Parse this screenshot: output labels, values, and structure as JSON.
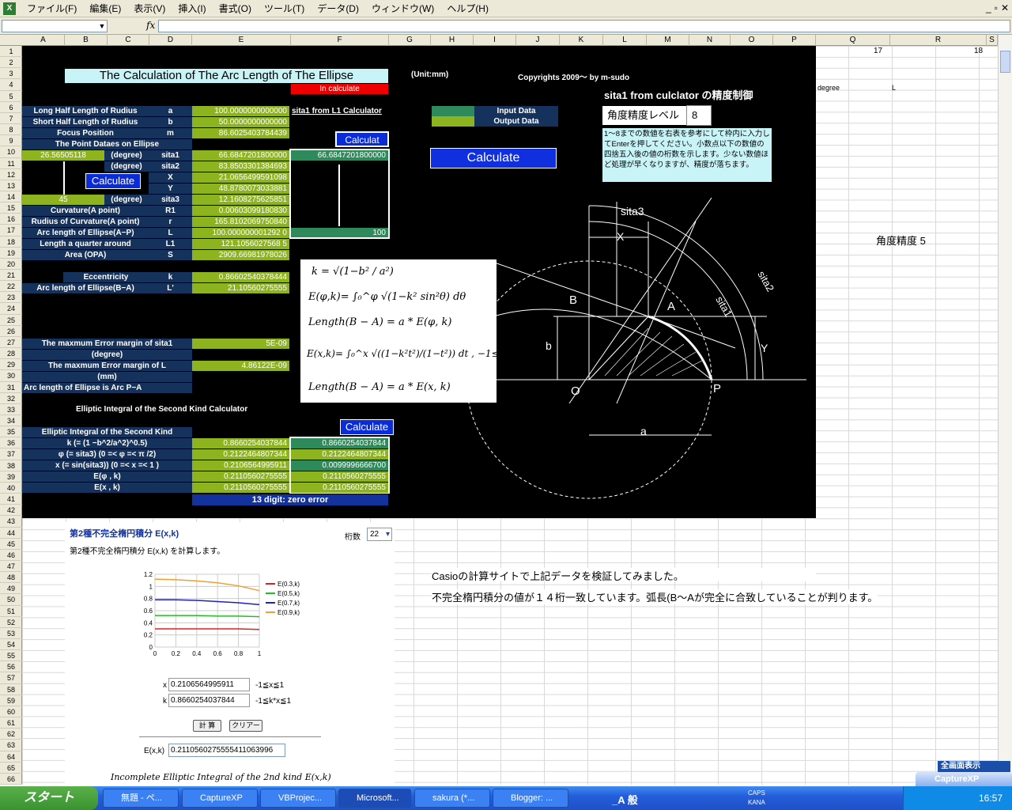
{
  "menu": [
    "ファイル(F)",
    "編集(E)",
    "表示(V)",
    "挿入(I)",
    "書式(O)",
    "ツール(T)",
    "データ(D)",
    "ウィンドウ(W)",
    "ヘルプ(H)"
  ],
  "window_controls": [
    "_",
    "▫",
    "✕"
  ],
  "formula": {
    "fx": "fx",
    "namebox_arrow": "▼"
  },
  "columns": [
    "A",
    "B",
    "C",
    "D",
    "E",
    "F",
    "G",
    "H",
    "I",
    "J",
    "K",
    "L",
    "M",
    "N",
    "O",
    "P",
    "Q",
    "R",
    "S"
  ],
  "rows": [
    "1",
    "2",
    "3",
    "4",
    "5",
    "6",
    "7",
    "8",
    "9",
    "10",
    "11",
    "12",
    "13",
    "14",
    "15",
    "16",
    "17",
    "18",
    "19",
    "20",
    "21",
    "22",
    "23",
    "24",
    "25",
    "26",
    "27",
    "28",
    "29",
    "30",
    "31",
    "32",
    "33",
    "34",
    "35",
    "36",
    "37",
    "38",
    "39",
    "40",
    "41",
    "42",
    "43",
    "44",
    "45",
    "46",
    "47",
    "48",
    "49",
    "50",
    "51",
    "52",
    "53",
    "54",
    "55",
    "56",
    "57",
    "58",
    "59",
    "60",
    "61",
    "62",
    "63",
    "64",
    "65",
    "66"
  ],
  "sheet": {
    "title": "The Calculation of The Arc Length of  The Ellipse",
    "unit": "(Unit:mm)",
    "copyright": "Copyrights 2009～ by m-sudo",
    "status": "In calculate",
    "q1": "17",
    "r1": "18",
    "q4": "degree",
    "r4": "L",
    "r_angle": "角度精度 5",
    "sita1_from": "sita1  from L1  Calculator",
    "legend_input": "Input Data",
    "legend_output": "Output Data",
    "ctrl_title": "sita1  from  culclator の精度制御",
    "ctrl_label": "角度精度レベル",
    "ctrl_value": "8",
    "ctrl_note": "1～8までの数値を右表を参考にして枠内に入力してEnterを押してください。小数点以下の数値の四捨五入後の値の桁数を示します。少ない数値ほど処理が早くなりますが、精度が落ちます。",
    "calc_btn": "Calculate",
    "calc_btn_small": "Calculat",
    "rows_main": [
      {
        "label": "Long Half Length of Rudius",
        "sym": "a",
        "val": "100.0000000000000"
      },
      {
        "label": "Short Half Length of Rudius",
        "sym": "b",
        "val": "50.0000000000000"
      },
      {
        "label": "Focus Position",
        "sym": "m",
        "val": "86.6025403784439"
      },
      {
        "label": "The Point Dataes on Ellipse",
        "sym": "",
        "val": ""
      }
    ],
    "a10": "26.56505118",
    "deg": "(degree)",
    "sym10": "sita1",
    "val10": "66.6847201800000",
    "out10": "66.6847201800000",
    "sym11": "sita2",
    "val11": "83.8503301384693",
    "sym12": "X",
    "val12": "21.0656499591098",
    "sym13": "Y",
    "val13": "48.8780073033881",
    "a14": "45",
    "sym14": "sita3",
    "val14": "12.1608275625851",
    "rows15": [
      {
        "label": "Curvature(A point)",
        "sym": "R1",
        "val": "0.00603099180830"
      },
      {
        "label": "Rudius of Curvature(A point)",
        "sym": "r",
        "val": "165.8102069750840"
      },
      {
        "label": "Arc length of Ellipse(A−P)",
        "sym": "L",
        "val": "100.000000001292 0"
      }
    ],
    "out17": "100",
    "l1_label": "Length a quarter around",
    "l1_sym": "L1",
    "l1_val": "121.1056027568 5",
    "area_label": "Area (OPA)",
    "area_sym": "S",
    "area_val": "2909.66981978026",
    "ecc_label": "Eccentricity",
    "ecc_sym": "k",
    "ecc_val": "0.86602540378444",
    "arcba_label": "Arc length of Ellipse(B−A)",
    "arcba_sym": "L'",
    "arcba_val": "21.10560275555",
    "err1_label": "The maxmum  Error margin  of sita1",
    "err1_label2": "(degree)",
    "err1_val": "5E-09",
    "err2_label": "The maxmum  Error margin  of L",
    "err2_label2": "(mm)",
    "err2_val": "4.86122E-09",
    "arcpa": "Arc length of Ellipse is Arc P−A",
    "ei_title": "Elliptic Integral of the Second Kind Calculator",
    "ei_head": "Elliptic Integral of the Second Kind",
    "ei_rows": [
      {
        "label": "k (= (1 −b^2/a^2)^0.5)",
        "v": "0.8660254037844",
        "o": "0.8660254037844"
      },
      {
        "label": "φ  (= sita3)  (0  =< φ  =< π /2)",
        "v": "0.2122464807344",
        "o": "0.2122464807344"
      },
      {
        "label": "x  (= sin(sita3))  (0  =< x =< 1 )",
        "v": "0.2106564995911",
        "o": "0.0099996666700"
      },
      {
        "label": "E(φ , k)",
        "v": "0.2110560275555",
        "o": "0.2110560275555"
      },
      {
        "label": "E(x , k)",
        "v": "0.2110560275555",
        "o": "0.2110560275555"
      }
    ],
    "zero_err": "13 digit: zero error",
    "formula": {
      "f1": "k = √(1−b² / a²)",
      "f2": "E(φ,k)= ∫₀^φ √(1−k² sin²θ)  dθ",
      "f3": "Length(B − A) = a * E(φ, k)",
      "f4": "E(x,k)= ∫₀^x √((1−k²t²)/(1−t²)) dt ,   −1≤x≤1",
      "f5": "Length(B − A) = a * E(x, k)"
    },
    "diagram": {
      "sita3": "sita3",
      "x": "X",
      "sita1": "sita1",
      "sita2": "sita2",
      "b_pt": "B",
      "a_pt": "A",
      "b": "b",
      "y": "Y",
      "o": "O",
      "p": "P",
      "a": "a"
    },
    "casio_note1": "Casioの計算サイトで上記データを検証してみました。",
    "casio_note2": "不完全楕円積分の値が１４桁一致しています。弧長(B～Aが完全に合致していることが判ります。"
  },
  "casio": {
    "title": "第2種不完全楕円積分 E(x,k)",
    "desc": "第2種不完全楕円積分 E(x,k) を計算します。",
    "digits_label": "桁数",
    "digits": "22",
    "chart_data": {
      "type": "line",
      "x": [
        0,
        0.2,
        0.4,
        0.6,
        0.8,
        1
      ],
      "ylim": [
        0,
        1.2
      ],
      "xticks": [
        "0",
        "0.2",
        "0.4",
        "0.6",
        "0.8",
        "1"
      ],
      "yticks": [
        "0",
        "0.2",
        "0.4",
        "0.6",
        "0.8",
        "1",
        "1.2"
      ],
      "series": [
        {
          "name": "E(0.3,k)",
          "color": "#e02020",
          "values": [
            0.3,
            0.3,
            0.3,
            0.3,
            0.3,
            0.29
          ]
        },
        {
          "name": "E(0.5,k)",
          "color": "#20c020",
          "values": [
            0.52,
            0.52,
            0.52,
            0.51,
            0.51,
            0.5
          ]
        },
        {
          "name": "E(0.7,k)",
          "color": "#2020c0",
          "values": [
            0.78,
            0.78,
            0.77,
            0.75,
            0.73,
            0.7
          ]
        },
        {
          "name": "E(0.9,k)",
          "color": "#f0a030",
          "values": [
            1.12,
            1.11,
            1.09,
            1.06,
            1.01,
            0.93
          ]
        }
      ]
    },
    "x_label": "x",
    "x_val": "0.2106564995911",
    "x_range": "-1≦x≦1",
    "k_label": "k",
    "k_val": "0.8660254037844",
    "k_range": "-1≦k*x≦1",
    "calc": "計 算",
    "clear": "クリアー",
    "result_label": "E(x,k)",
    "result": "0.2110560275555411063996",
    "footer": "Incomplete Elliptic Integral of the 2nd kind E(x,k)"
  },
  "taskbar": {
    "start": "スタート",
    "items": [
      "無題 - ペ...",
      "CaptureXP",
      "VBProjec...",
      "Microsoft...",
      "sakura (*...",
      "Blogger: ..."
    ],
    "ime": "_A 般",
    "caps": "CAPS",
    "kana": "KANA",
    "clock": "16:57",
    "capturexp_popup": "CaptureXP",
    "fullscreen": "全画面表示"
  }
}
